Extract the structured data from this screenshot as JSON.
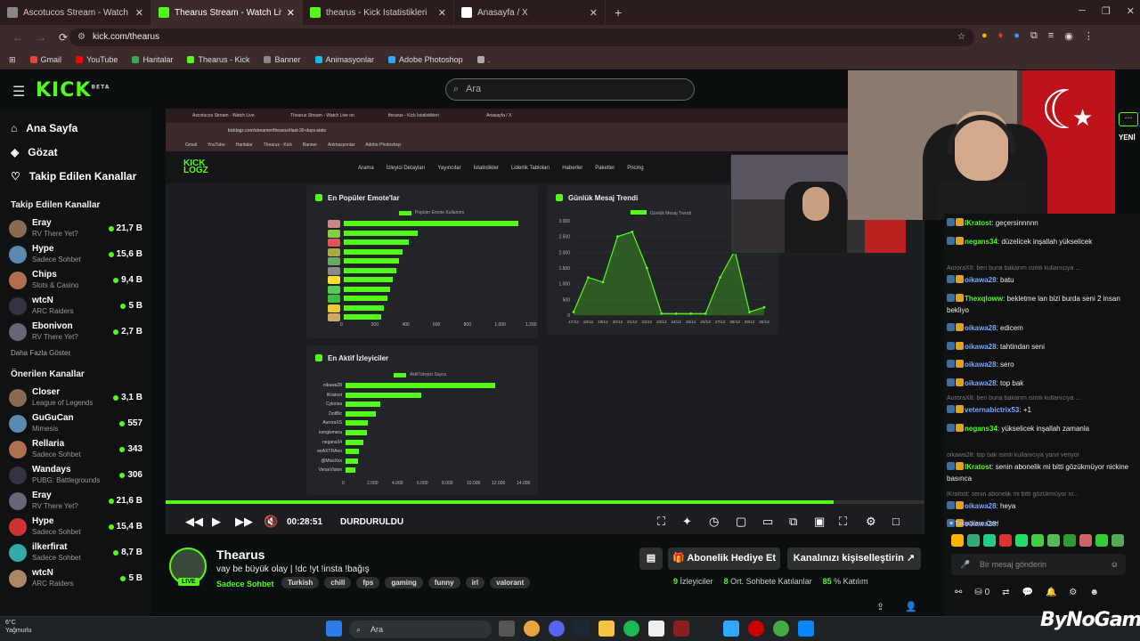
{
  "browser": {
    "tabs": [
      {
        "title": "Ascotucos Stream - Watch Live",
        "icon": "avatar-icon"
      },
      {
        "title": "Thearus Stream - Watch Live on Kick",
        "icon": "kick-icon"
      },
      {
        "title": "thearus - Kick İstatistikleri",
        "icon": "kicklogz-icon"
      },
      {
        "title": "Anasayfa / X",
        "icon": "x-icon"
      }
    ],
    "new_tab": "+",
    "url": "kick.com/thearus",
    "bookmarks": [
      "Gmail",
      "YouTube",
      "Haritalar",
      "Thearus - Kick",
      "Banner",
      "Animasyonlar",
      "Adobe Photoshop",
      "."
    ]
  },
  "kick": {
    "logo": "KICK",
    "logo_sup": "BETA",
    "search_placeholder": "Ara",
    "nav": [
      {
        "label": "Ana Sayfa",
        "icon": "home-icon"
      },
      {
        "label": "Gözat",
        "icon": "browse-icon"
      },
      {
        "label": "Takip Edilen Kanallar",
        "icon": "heart-icon"
      }
    ],
    "followed_header": "Takip Edilen Kanallar",
    "followed": [
      {
        "name": "Eray",
        "cat": "RV There Yet?",
        "viewers": "21,7 B"
      },
      {
        "name": "Hype",
        "cat": "Sadece Sohbet",
        "viewers": "15,6 B"
      },
      {
        "name": "Chips",
        "cat": "Slots & Casino",
        "viewers": "9,4 B"
      },
      {
        "name": "wtcN",
        "cat": "ARC Raiders",
        "viewers": "5 B"
      },
      {
        "name": "Ebonivon",
        "cat": "RV There Yet?",
        "viewers": "2,7 B"
      }
    ],
    "show_more": "Daha Fazla Göster",
    "recommended_header": "Önerilen Kanallar",
    "recommended": [
      {
        "name": "Closer",
        "cat": "League of Legends",
        "viewers": "3,1 B"
      },
      {
        "name": "GuGuCan",
        "cat": "Mimesis",
        "viewers": "557"
      },
      {
        "name": "Rellaria",
        "cat": "Sadece Sohbet",
        "viewers": "343"
      },
      {
        "name": "Wandays",
        "cat": "PUBG: Battlegrounds",
        "viewers": "306"
      },
      {
        "name": "Eray",
        "cat": "RV There Yet?",
        "viewers": "21,6 B"
      },
      {
        "name": "Hype",
        "cat": "Sadece Sohbet",
        "viewers": "15,4 B"
      },
      {
        "name": "ilkerfirat",
        "cat": "Sadece Sohbet",
        "viewers": "8,7 B"
      },
      {
        "name": "wtcN",
        "cat": "ARC Raiders",
        "viewers": "5 B"
      }
    ]
  },
  "inner": {
    "tabs": [
      "Ascotucos Stream - Watch Live",
      "Thearus Stream - Watch Live on",
      "thearus - Kick İstatistikleri",
      "Anasayfa / X"
    ],
    "url": "kicklogz.com/streamer/thearus#last-30-days-stats",
    "bookmarks": [
      "Gmail",
      "YouTube",
      "Haritalar",
      "Thearus - Kick",
      "Banner",
      "Animasyonlar",
      "Adobe Photoshop"
    ],
    "logo": "KICK",
    "logo2": "LOGZ",
    "nav": [
      "Arama",
      "İzleyici Detayları",
      "Yayıncılar",
      "İstatistikler",
      "Liderlik Tabloları",
      "Haberler",
      "Paketler",
      "Pricing"
    ]
  },
  "emote_chart_title": "En Popüler Emote'lar",
  "message_chart_title": "Günlük Mesaj Trendi",
  "viewer_chart_title": "En Aktif İzleyiciler",
  "chart_data": [
    {
      "type": "bar",
      "title": "En Popüler Emote'lar",
      "legend": "Popüler Emote Kullanımı",
      "orientation": "horizontal",
      "values": [
        1130,
        480,
        420,
        380,
        360,
        340,
        320,
        300,
        280,
        260,
        240
      ],
      "xticks": [
        "0",
        "200",
        "400",
        "600",
        "800",
        "1.000",
        "1.200"
      ],
      "xlim": [
        0,
        1200
      ]
    },
    {
      "type": "area",
      "title": "Günlük Mesaj Trendi",
      "legend": "Günlük Mesaj Trendi",
      "x": [
        "17/12",
        "18/12",
        "19/12",
        "20/12",
        "21/12",
        "22/12",
        "23/12",
        "24/12",
        "25/12",
        "26/12",
        "27/12",
        "28/12",
        "29/12",
        "30/12"
      ],
      "values": [
        100,
        1200,
        1050,
        2500,
        2650,
        1500,
        50,
        50,
        50,
        50,
        1200,
        2050,
        100,
        250
      ],
      "yticks": [
        "0",
        "500",
        "1.000",
        "1.500",
        "2.000",
        "2.500",
        "3.000"
      ],
      "ylim": [
        0,
        3000
      ]
    },
    {
      "type": "bar",
      "title": "En Aktif İzleyiciler",
      "legend": "Aktif İzleyici Sayısı",
      "orientation": "horizontal",
      "categories": [
        "oikawa28",
        "lKratost",
        "Cylorisa",
        "DotBlc",
        "AuroraXS",
        "kongismera",
        "negans34",
        "eeAXTRAoo",
        "@MissXss",
        "VerseVision"
      ],
      "values": [
        12000,
        6100,
        2800,
        2400,
        1800,
        1700,
        1400,
        1100,
        1000,
        800
      ],
      "xticks": [
        "0",
        "2.000",
        "4.000",
        "6.000",
        "8.000",
        "10.000",
        "12.000",
        "14.000"
      ],
      "xlim": [
        0,
        14000
      ]
    }
  ],
  "player": {
    "time": "00:28:51",
    "status": "DURDURULDU"
  },
  "stream": {
    "name": "Thearus",
    "title": "vay be büyük olay | !dc !yt !insta !bağış",
    "category": "Sadece Sohbet",
    "tags": [
      "Turkish",
      "chill",
      "fps",
      "gaming",
      "funny",
      "irl",
      "valorant"
    ],
    "live": "LIVE",
    "gift": "Abonelik Hediye Et",
    "customize": "Kanalınızı kişiselleştirin",
    "viewers": "9",
    "viewers_label": "İzleyiciler",
    "avg": "8",
    "avg_label": "Ort. Sohbete Katılanlar",
    "pct": "85",
    "pct_label": "% Katılım"
  },
  "chat": {
    "new_badge": "YENİ",
    "messages": [
      {
        "kind": "msg",
        "user": "lKratost",
        "color": "#53fc18",
        "text": "geçersinnnnn"
      },
      {
        "kind": "msg",
        "user": "negans34",
        "color": "#53fc18",
        "text": "düzelicek inşallah yükselicek"
      },
      {
        "kind": "reply",
        "text": "AuroraX8: ben buna bakarım isimli kullanıcıya ..."
      },
      {
        "kind": "msg",
        "user": "oikawa28",
        "color": "#7aa7ff",
        "text": "batu"
      },
      {
        "kind": "msg",
        "user": "Thexqloww",
        "color": "#53fc18",
        "text": "bekletme lan bizi burda seni 2 insan bekliyo"
      },
      {
        "kind": "msg",
        "user": "oikawa28",
        "color": "#7aa7ff",
        "text": "edicem"
      },
      {
        "kind": "msg",
        "user": "oikawa28",
        "color": "#7aa7ff",
        "text": "tahtindan seni"
      },
      {
        "kind": "msg",
        "user": "oikawa28",
        "color": "#7aa7ff",
        "text": "sero"
      },
      {
        "kind": "msg",
        "user": "oikawa28",
        "color": "#7aa7ff",
        "text": "top bak"
      },
      {
        "kind": "reply",
        "text": "AuroraX8: ben buna bakarım isimli kullanıcıya ..."
      },
      {
        "kind": "msg",
        "user": "veternabictrix53",
        "color": "#7aa7ff",
        "text": "+1"
      },
      {
        "kind": "msg",
        "user": "negans34",
        "color": "#53fc18",
        "text": "yükselicek inşallah zamanla"
      },
      {
        "kind": "reply",
        "text": "oikawa28: top bak isimli kullanıcıya yanıt veriyor"
      },
      {
        "kind": "msg",
        "user": "lKratost",
        "color": "#53fc18",
        "text": "senin abonelik mi bitti gözükmüyor nickine basınca"
      },
      {
        "kind": "reply",
        "text": "lKratost: senin abonelik mi bitti gözükmüyor ni..."
      },
      {
        "kind": "msg",
        "user": "oikawa28",
        "color": "#7aa7ff",
        "text": "heya"
      },
      {
        "kind": "msg",
        "user": "oikawa28",
        "color": "#7aa7ff",
        "text": ""
      }
    ],
    "followers_only": "Takipçilere Özel",
    "input_placeholder": "Bir mesaj gönderin",
    "footer_count": "0"
  },
  "taskbar": {
    "temp": "6°C",
    "weather": "Yağmurlu",
    "search": "Ara"
  },
  "watermark": "ByNoGame"
}
